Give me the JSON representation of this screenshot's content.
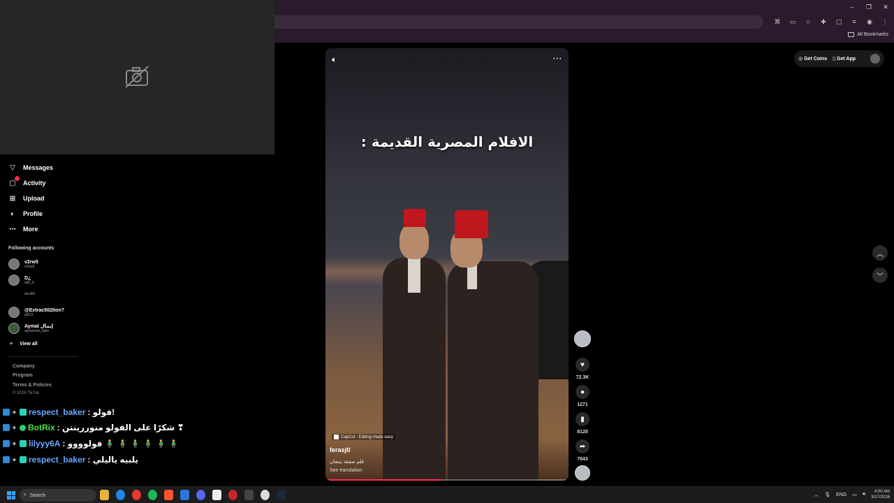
{
  "browser": {
    "bookmarks_label": "All Bookmarks",
    "win_controls": [
      "–",
      "❐",
      "✕"
    ]
  },
  "sidebar": {
    "nav": [
      {
        "label": "Messages",
        "icon": "send-icon"
      },
      {
        "label": "Activity",
        "icon": "inbox-icon"
      },
      {
        "label": "Upload",
        "icon": "upload-icon"
      },
      {
        "label": "Profile",
        "icon": "profile-icon"
      },
      {
        "label": "More",
        "icon": "more-icon"
      }
    ],
    "following_title": "Following accounts",
    "accounts": [
      {
        "name": "v2rw5",
        "handle": "v2rw5"
      },
      {
        "name": "D¿",
        "handle": "xlls_5"
      },
      {
        "name": "",
        "handle": "wru83"
      },
      {
        "name": "@Extrac502tion?",
        "handle": "o813"
      },
      {
        "name": "Aymal إيمال",
        "handle": "aymasxb_labs"
      }
    ],
    "view_all": "View all",
    "footer": [
      "Company",
      "Program",
      "Terms & Policies"
    ],
    "copyright": "© 2026 TikTok"
  },
  "chat": [
    {
      "user": "respect_baker",
      "msg": ": فولو!",
      "user_color": "blue"
    },
    {
      "user": "BotRix",
      "msg": ": شكرًا على الفولو منورريننن ❣",
      "user_color": "green"
    },
    {
      "user": "lilyyy6A",
      "msg": ": فولوووو 🧍‍♂️ 🧍‍♂️ 🧍‍♂️ 🧍‍♂️ 🧍‍♂️ 🧍‍♂️",
      "user_color": "blue"
    },
    {
      "user": "respect_baker",
      "msg": ": يلبيه ياليلي",
      "user_color": "blue"
    }
  ],
  "video": {
    "caption": "الافلام المصرية القديمة :",
    "capcut": "CapCut · Editing made easy",
    "author": "ferasjtl",
    "description": "فلم صفقة بتنجان",
    "see_translation": "See translation",
    "progress": 0.48
  },
  "actions": {
    "likes": "72.3K",
    "comments": "1271",
    "saves": "8128",
    "shares": "7643"
  },
  "top_buttons": {
    "coins": "Get Coins",
    "app": "Get App"
  },
  "taskbar": {
    "search": "Search",
    "lang": "ENG",
    "time": "4:00 AM",
    "date": "3/17/2026"
  }
}
